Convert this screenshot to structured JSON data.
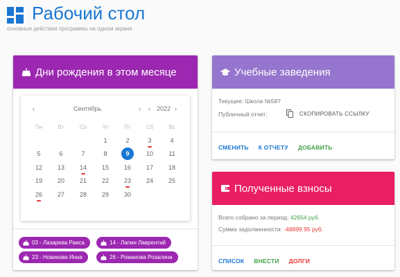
{
  "header": {
    "title": "Рабочий стол",
    "subtitle": "основные действия программы на одном экране",
    "accent": "#1976d2"
  },
  "birthdays": {
    "title": "Дни рождения в этом месяце",
    "color": "#9c27b0",
    "calendar": {
      "month": "Сентябрь",
      "year": "2022",
      "weekdays": [
        "Пн",
        "Вт",
        "Ср",
        "Чт",
        "Пт",
        "Сб",
        "Вс"
      ],
      "weeks": [
        [
          "",
          "",
          "",
          "1",
          "2",
          "3",
          "4"
        ],
        [
          "5",
          "6",
          "7",
          "8",
          "9",
          "10",
          "11"
        ],
        [
          "12",
          "13",
          "14",
          "15",
          "16",
          "17",
          "18"
        ],
        [
          "19",
          "20",
          "21",
          "22",
          "23",
          "24",
          "25"
        ],
        [
          "26",
          "27",
          "28",
          "29",
          "30",
          "",
          ""
        ]
      ],
      "today": "9",
      "marked": [
        "3",
        "14",
        "23",
        "26"
      ]
    },
    "chips": [
      "03 - Лазарева Раиса",
      "14 - Лапин Лаврентий",
      "23 - Новикова Инна",
      "26 - Романова Розалина"
    ]
  },
  "schools": {
    "title": "Учебные заведения",
    "color": "#9575cd",
    "current": "Текущее: Школа №587",
    "public_report_label": "Публичный отчет:",
    "copy_link": "СКОПИРОВАТЬ ССЫЛКУ",
    "actions": {
      "change": "СМЕНИТЬ",
      "report": "К ОТЧЕТУ",
      "add": "ДОБАВИТЬ"
    }
  },
  "fees": {
    "title": "Полученные взносы",
    "color": "#e91e63",
    "collected_label": "Всего собрано за период:",
    "collected_value": "42654 руб.",
    "debt_label": "Сумма задолженности:",
    "debt_value": "-48899.95 руб.",
    "actions": {
      "list": "СПИСОК",
      "deposit": "ВНЕСТИ",
      "debts": "ДОЛГИ"
    }
  }
}
